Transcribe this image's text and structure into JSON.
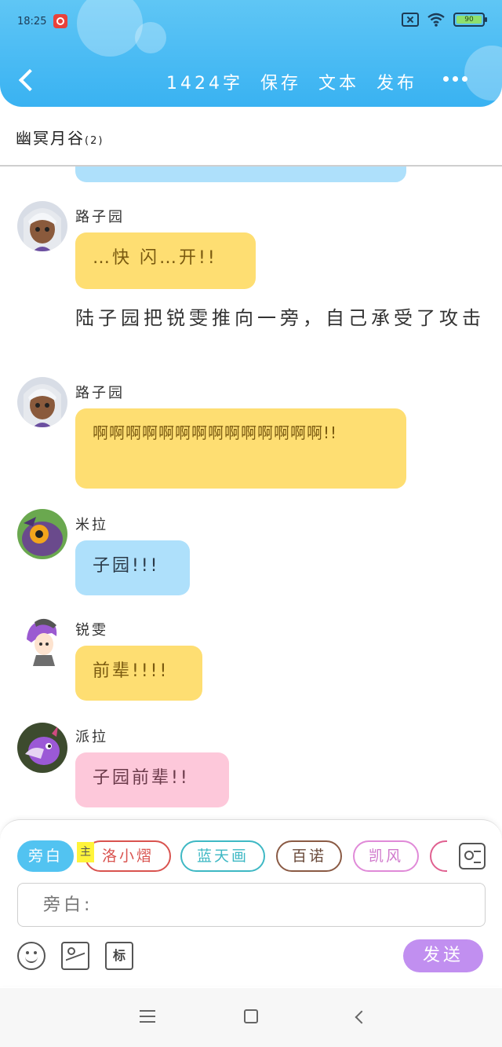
{
  "status_bar": {
    "time": "18:25",
    "battery": "90"
  },
  "header": {
    "word_count": "1424字",
    "actions": [
      "保存",
      "文本",
      "发布"
    ]
  },
  "chat": {
    "title": "幽冥月谷",
    "member_count": "(2)"
  },
  "messages": [
    {
      "type": "character",
      "name": "路子园",
      "text": "…快 闪…开!!",
      "color": "yellow",
      "avatar_icon": "white-haired-girl-avatar"
    },
    {
      "type": "narration",
      "text": "陆子园把锐雯推向一旁，自己承受了攻击"
    },
    {
      "type": "character",
      "name": "路子园",
      "text": "啊啊啊啊啊啊啊啊啊啊啊啊啊啊!!",
      "color": "yellow",
      "avatar_icon": "white-haired-girl-avatar"
    },
    {
      "type": "character",
      "name": "米拉",
      "text": "子园!!!",
      "color": "blue",
      "avatar_icon": "purple-creature-avatar"
    },
    {
      "type": "character",
      "name": "锐雯",
      "text": "前辈!!!!",
      "color": "yellow",
      "avatar_icon": "purple-haired-boy-avatar"
    },
    {
      "type": "character",
      "name": "派拉",
      "text": "子园前辈!!",
      "color": "pink",
      "avatar_icon": "purple-dragon-avatar"
    }
  ],
  "composer": {
    "roles": [
      "旁白",
      "洛小熠",
      "蓝天画",
      "百诺",
      "凯风",
      ""
    ],
    "main_tag": "主",
    "input_placeholder": "旁白:",
    "tag_button": "标",
    "send_label": "发送"
  },
  "colors": {
    "header": "#39b2f2",
    "yellow_bubble": "#fede72",
    "blue_bubble": "#aee0fb",
    "pink_bubble": "#fdc8da",
    "send_button": "#c18ff0"
  }
}
